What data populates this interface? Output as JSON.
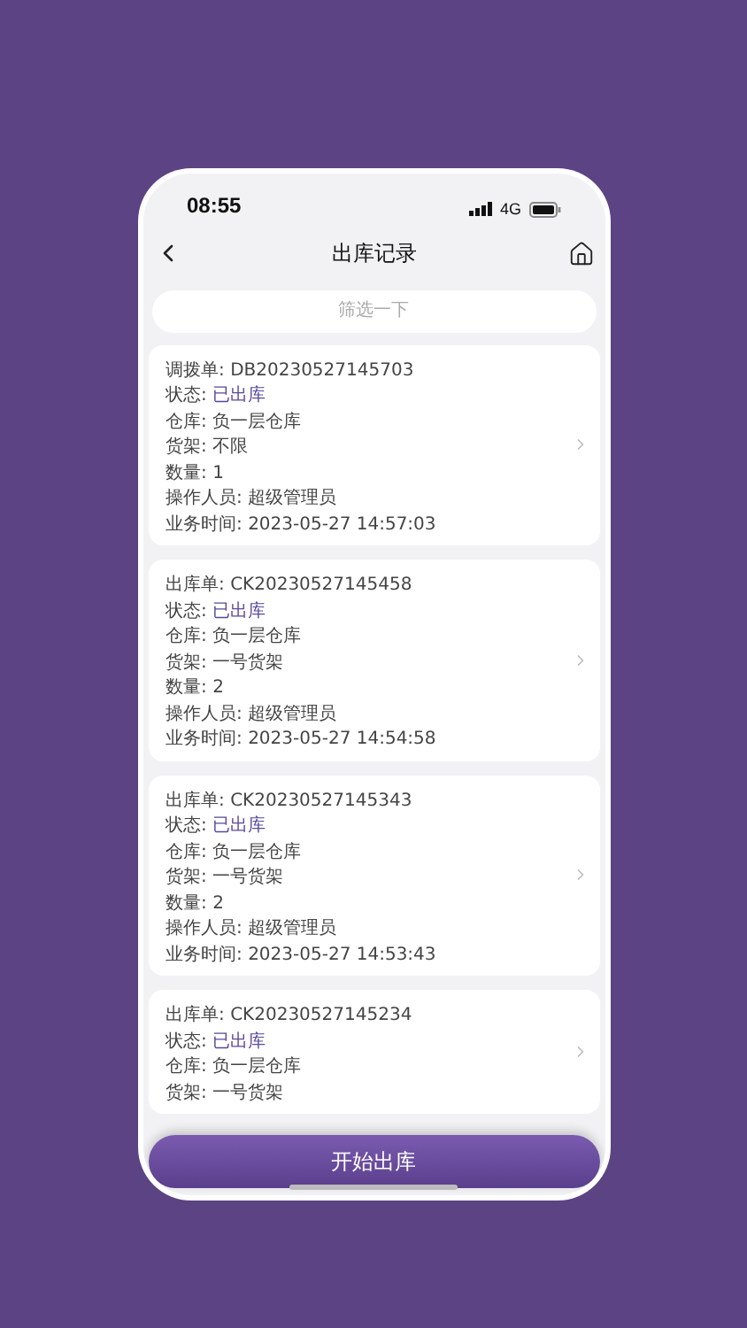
{
  "status_bar": {
    "time": "08:55",
    "network": "4G"
  },
  "nav": {
    "title": "出库记录"
  },
  "filter": {
    "placeholder": "筛选一下"
  },
  "records": [
    {
      "fields": [
        {
          "kind": "text",
          "label": "调拨单:",
          "value": "DB20230527145703"
        },
        {
          "kind": "status",
          "label": "状态:",
          "value": "已出库"
        },
        {
          "kind": "text",
          "label": "仓库:",
          "value": "负一层仓库"
        },
        {
          "kind": "text",
          "label": "货架:",
          "value": "不限"
        },
        {
          "kind": "text",
          "label": "数量:",
          "value": "1"
        },
        {
          "kind": "text",
          "label": "操作人员:",
          "value": "超级管理员"
        },
        {
          "kind": "text",
          "label": "业务时间:",
          "value": "2023-05-27 14:57:03"
        }
      ]
    },
    {
      "fields": [
        {
          "kind": "text",
          "label": "出库单:",
          "value": "CK20230527145458"
        },
        {
          "kind": "status",
          "label": "状态:",
          "value": "已出库"
        },
        {
          "kind": "text",
          "label": "仓库:",
          "value": "负一层仓库"
        },
        {
          "kind": "text",
          "label": "货架:",
          "value": "一号货架"
        },
        {
          "kind": "text",
          "label": "数量:",
          "value": "2"
        },
        {
          "kind": "text",
          "label": "操作人员:",
          "value": "超级管理员"
        },
        {
          "kind": "text",
          "label": "业务时间:",
          "value": "2023-05-27 14:54:58"
        }
      ]
    },
    {
      "fields": [
        {
          "kind": "text",
          "label": "出库单:",
          "value": "CK20230527145343"
        },
        {
          "kind": "status",
          "label": "状态:",
          "value": "已出库"
        },
        {
          "kind": "text",
          "label": "仓库:",
          "value": "负一层仓库"
        },
        {
          "kind": "text",
          "label": "货架:",
          "value": "一号货架"
        },
        {
          "kind": "text",
          "label": "数量:",
          "value": "2"
        },
        {
          "kind": "text",
          "label": "操作人员:",
          "value": "超级管理员"
        },
        {
          "kind": "text",
          "label": "业务时间:",
          "value": "2023-05-27 14:53:43"
        }
      ]
    },
    {
      "fields": [
        {
          "kind": "text",
          "label": "出库单:",
          "value": "CK20230527145234"
        },
        {
          "kind": "status",
          "label": "状态:",
          "value": "已出库"
        },
        {
          "kind": "text",
          "label": "仓库:",
          "value": "负一层仓库"
        },
        {
          "kind": "text",
          "label": "货架:",
          "value": "一号货架"
        }
      ]
    }
  ],
  "primary_button": {
    "label": "开始出库"
  }
}
